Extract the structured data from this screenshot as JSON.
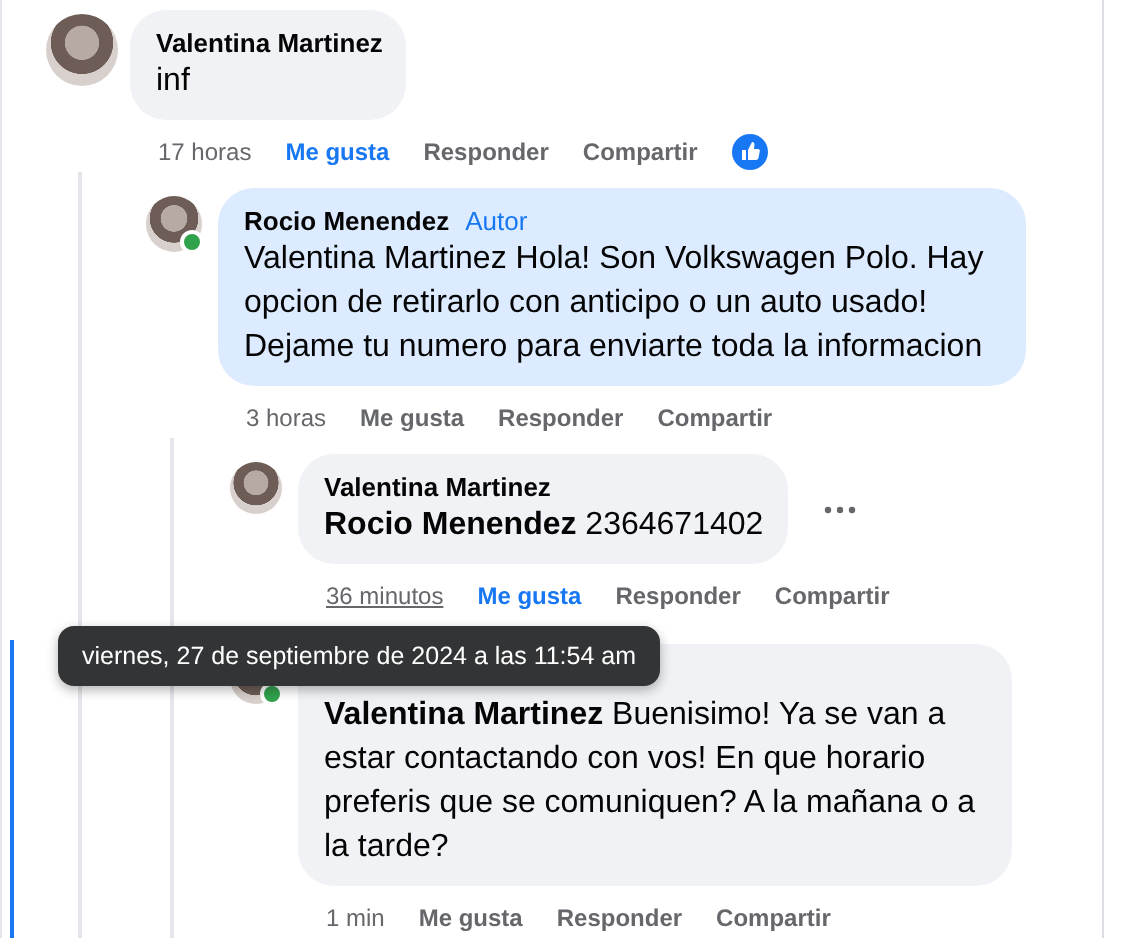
{
  "comments": [
    {
      "name": "Valentina Martinez",
      "highlighted": false,
      "text": "inf",
      "time": "17 horas",
      "time_hovered": false,
      "liked": true,
      "actions": [
        "Me gusta",
        "Responder",
        "Compartir"
      ],
      "reaction": true,
      "children": [
        {
          "name": "Rocio Menendez",
          "author_badge": "Autor",
          "online": true,
          "highlighted": true,
          "text": "Valentina Martinez Hola! Son Volkswagen Polo. Hay opcion de retirarlo con anticipo o un auto usado! Dejame tu numero para enviarte toda la informacion",
          "time": "3 horas",
          "time_hovered": false,
          "liked": false,
          "actions": [
            "Me gusta",
            "Responder",
            "Compartir"
          ],
          "children": [
            {
              "name": "Valentina Martinez",
              "highlighted": false,
              "text": "**Rocio Menendez** 2364671402",
              "time": "36 minutos",
              "time_hovered": true,
              "liked": true,
              "actions": [
                "Me gusta",
                "Responder",
                "Compartir"
              ],
              "menu": true
            },
            {
              "online": true,
              "highlighted": false,
              "text": "**Valentina Martinez** Buenisimo! Ya se van a estar contactando con vos! En que horario preferis que se comuniquen? A la mañana o a la tarde?",
              "time": "1 min",
              "time_hovered": false,
              "liked": false,
              "actions": [
                "Me gusta",
                "Responder",
                "Compartir"
              ]
            }
          ]
        }
      ]
    }
  ],
  "tooltip": {
    "text": "viernes, 27 de septiembre de 2024 a las 11:54 am"
  }
}
